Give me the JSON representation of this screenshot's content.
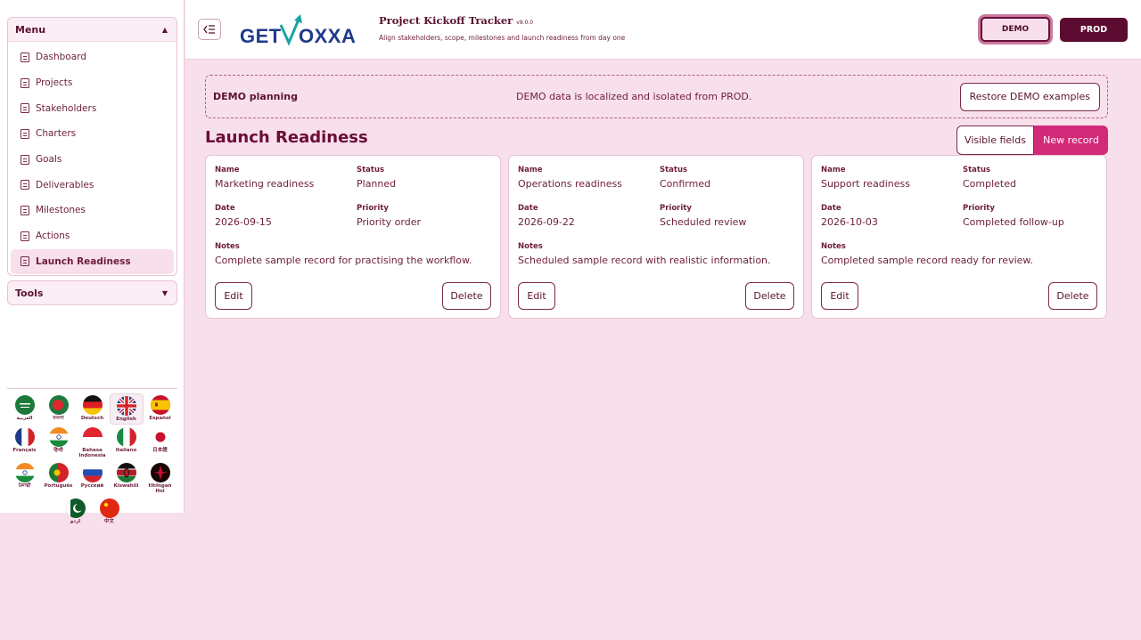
{
  "sidebar": {
    "menu_title": "Menu",
    "tools_title": "Tools",
    "items": [
      {
        "label": "Dashboard",
        "icon": "document-icon"
      },
      {
        "label": "Projects",
        "icon": "document-icon"
      },
      {
        "label": "Stakeholders",
        "icon": "document-icon"
      },
      {
        "label": "Charters",
        "icon": "document-icon"
      },
      {
        "label": "Goals",
        "icon": "document-icon"
      },
      {
        "label": "Deliverables",
        "icon": "document-icon"
      },
      {
        "label": "Milestones",
        "icon": "document-icon"
      },
      {
        "label": "Actions",
        "icon": "document-icon"
      },
      {
        "label": "Launch Readiness",
        "icon": "document-icon",
        "active": true
      }
    ],
    "languages": [
      {
        "label": "العربية"
      },
      {
        "label": "বাংলা"
      },
      {
        "label": "Deutsch"
      },
      {
        "label": "English",
        "active": true
      },
      {
        "label": "Español"
      },
      {
        "label": "Français"
      },
      {
        "label": "हिन्दी"
      },
      {
        "label": "Bahasa Indonesia"
      },
      {
        "label": "Italiano"
      },
      {
        "label": "日本語"
      },
      {
        "label": "ਪੰਜਾਬੀ"
      },
      {
        "label": "Português"
      },
      {
        "label": "Русский"
      },
      {
        "label": "Kiswahili"
      },
      {
        "label": "tlhIngan Hol"
      },
      {
        "label": "اردو"
      },
      {
        "label": "中文"
      }
    ]
  },
  "header": {
    "logo_text": "GETVOXXA",
    "title": "Project Kickoff Tracker",
    "version": "v9.0.0",
    "subtitle": "Align stakeholders, scope, milestones and launch readiness from day one",
    "env_demo": "DEMO",
    "env_prod": "PROD"
  },
  "banner": {
    "title": "DEMO planning",
    "message": "DEMO data is localized and isolated from PROD.",
    "restore_label": "Restore DEMO examples"
  },
  "section": {
    "title": "Launch Readiness",
    "visible_fields_label": "Visible fields",
    "new_record_label": "New record"
  },
  "labels": {
    "name": "Name",
    "status": "Status",
    "date": "Date",
    "priority": "Priority",
    "notes": "Notes",
    "edit": "Edit",
    "delete": "Delete"
  },
  "records": [
    {
      "name": "Marketing readiness",
      "status": "Planned",
      "date": "2026-09-15",
      "priority": "Priority order",
      "notes": "Complete sample record for practising the workflow."
    },
    {
      "name": "Operations readiness",
      "status": "Confirmed",
      "date": "2026-09-22",
      "priority": "Scheduled review",
      "notes": "Scheduled sample record with realistic information."
    },
    {
      "name": "Support readiness",
      "status": "Completed",
      "date": "2026-10-03",
      "priority": "Completed follow-up",
      "notes": "Completed sample record ready for review."
    }
  ],
  "colors": {
    "background": "#f8dfec",
    "accent": "#d22a78",
    "prod": "#5c0c30",
    "text": "#5a1230"
  }
}
